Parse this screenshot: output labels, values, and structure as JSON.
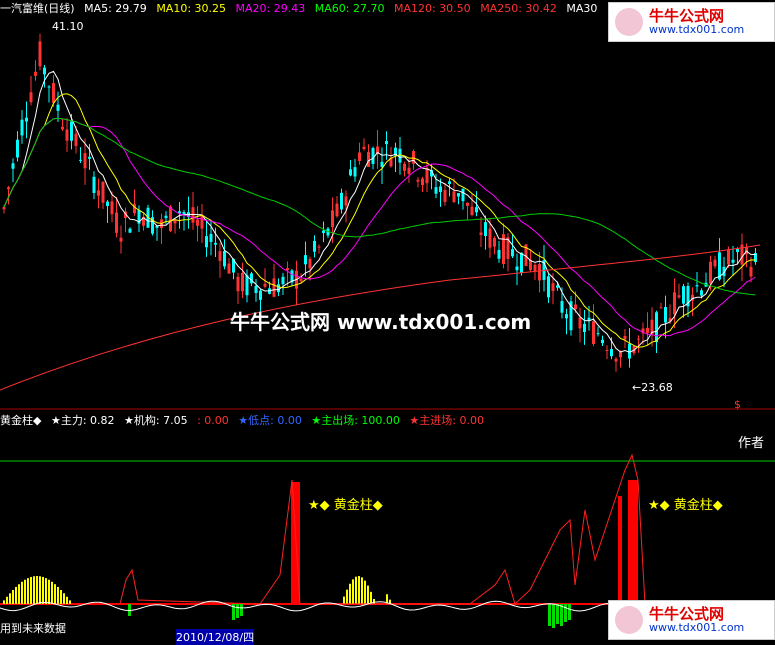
{
  "header": {
    "stock": "一汽富维(日线)",
    "ma5": "MA5: 29.79",
    "ma10": "MA10: 30.25",
    "ma20": "MA20: 29.43",
    "ma60": "MA60: 27.70",
    "ma120": "MA120: 30.50",
    "ma250": "MA250: 30.42",
    "ma30": "MA30"
  },
  "main": {
    "high_label": "41.10",
    "low_label": "←23.68",
    "watermark": "牛牛公式网 www.tdx001.com"
  },
  "indicator": {
    "gold_pillar": "黄金柱◆",
    "zhuli": "★主力: 0.82",
    "jigou": "★机构: 7.05",
    "jigou_val": ": 0.00",
    "didian": "★低点: 0.00",
    "chuchang": "★主出场: 100.00",
    "jinchang": "★主进场: 0.00",
    "author": "作者",
    "marker_left": "★◆  黄金柱◆",
    "marker_right": "★◆  黄金柱◆",
    "bottom_left": "用到未来数据",
    "date_tag": "2010/12/08/四"
  },
  "logo": {
    "title": "牛牛公式网",
    "url": "www.tdx001.com"
  },
  "colors": {
    "up": "#ff3333",
    "down": "#00ffff",
    "ma5": "#ffffff",
    "ma10": "#ffff00",
    "ma20": "#ff00ff",
    "ma60": "#00cc00",
    "ma120": "#ff3333",
    "ma250": "#cc3333"
  }
}
